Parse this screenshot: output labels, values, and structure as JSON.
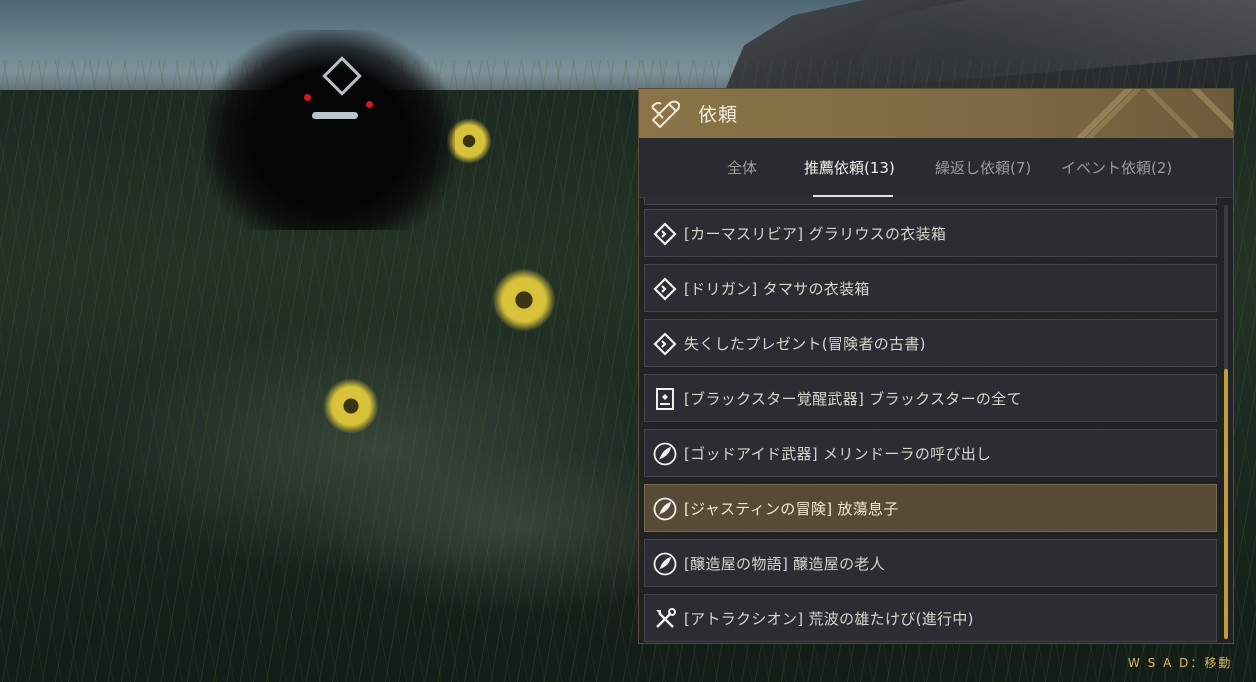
{
  "window": {
    "title": "依頼",
    "icon": "scroll-quill-icon"
  },
  "tabs": [
    {
      "label": "全体",
      "active": false
    },
    {
      "label": "推薦依頼(13)",
      "active": true
    },
    {
      "label": "繰返し依頼(7)",
      "active": false
    },
    {
      "label": "イベント依頼(2)",
      "active": false
    }
  ],
  "quests": [
    {
      "label": "",
      "icon": "diamond-icon",
      "selected": false
    },
    {
      "label": "[カーマスリビア] グラリウスの衣装箱",
      "icon": "diamond-icon",
      "selected": false
    },
    {
      "label": "[ドリガン] タマサの衣装箱",
      "icon": "diamond-icon",
      "selected": false
    },
    {
      "label": "失くしたプレゼント(冒険者の古書)",
      "icon": "diamond-icon",
      "selected": false
    },
    {
      "label": "[ブラックスター覚醒武器] ブラックスターの全て",
      "icon": "book-icon",
      "selected": false
    },
    {
      "label": "[ゴッドアイド武器] メリンドーラの呼び出し",
      "icon": "feather-icon",
      "selected": false
    },
    {
      "label": "[ジャスティンの冒険] 放蕩息子",
      "icon": "feather-icon",
      "selected": true
    },
    {
      "label": "[醸造屋の物語] 醸造屋の老人",
      "icon": "feather-icon",
      "selected": false
    },
    {
      "label": "[アトラクシオン] 荒波の雄たけび(進行中)",
      "icon": "crossed-tools-icon",
      "selected": false
    }
  ],
  "hint": {
    "text": "W S A D：移動"
  },
  "colors": {
    "header": "#8a7448",
    "selected_row": "#574a37",
    "scrollbar": "#c49b3d",
    "hint": "#d7b866"
  }
}
